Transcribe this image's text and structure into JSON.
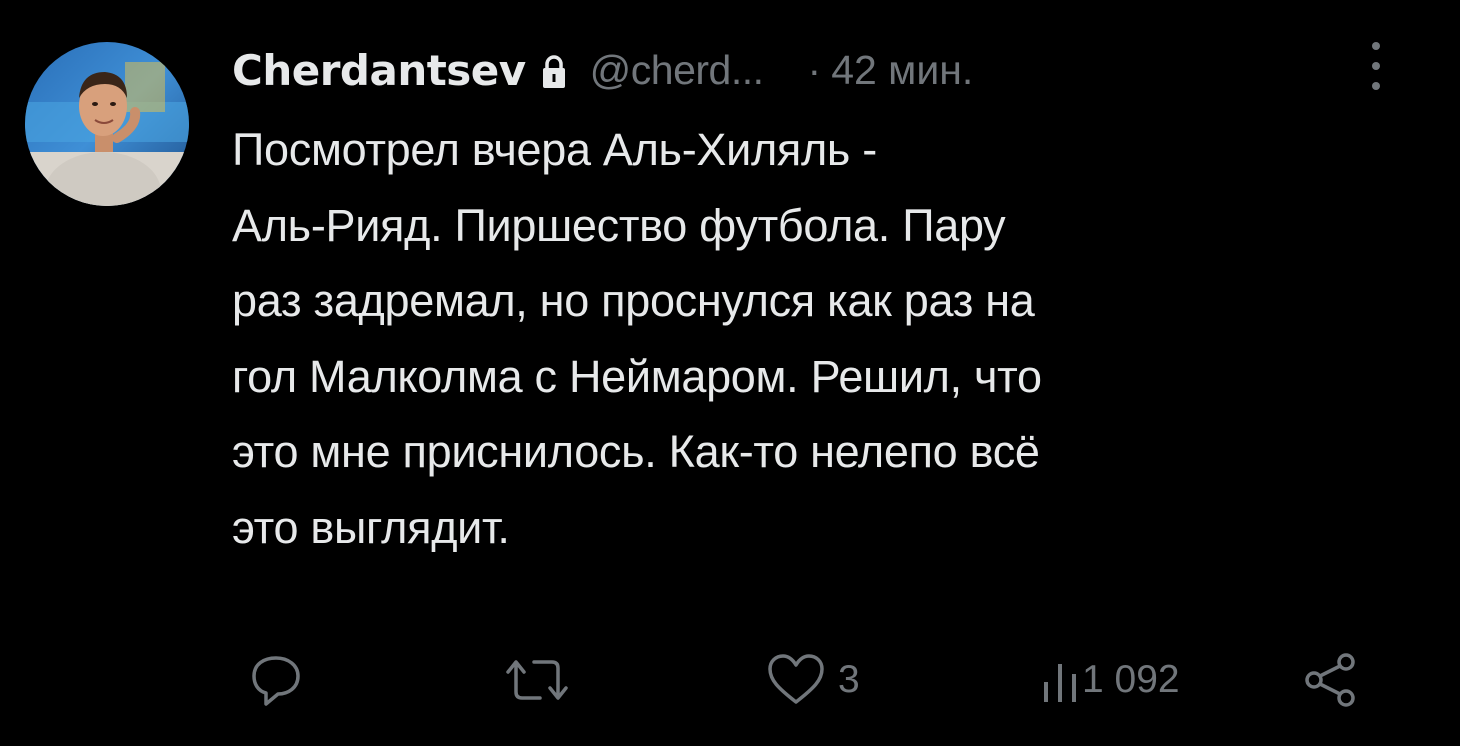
{
  "author": {
    "display_name": "Cherdantsev",
    "handle": "@cherd...",
    "separator": "·",
    "time": "42 мин.",
    "verified_icon": "lock-icon"
  },
  "tweet": {
    "lines": [
      "Посмотрел вчера Аль-Хиляль -",
      "Аль-Рияд. Пиршество футбола. Пару",
      "раз задремал, но проснулся как раз на",
      "гол Малколма с Неймаром. Решил, что",
      "это мне приснилось. Как-то нелепо всё",
      "это выглядит."
    ]
  },
  "actions": {
    "reply": {
      "icon": "reply-icon",
      "count": ""
    },
    "repost": {
      "icon": "repost-icon",
      "count": ""
    },
    "like": {
      "icon": "heart-icon",
      "count": "3"
    },
    "views": {
      "icon": "views-icon",
      "count": "1 092"
    },
    "share": {
      "icon": "share-icon"
    }
  },
  "more_icon": "more-vertical-icon",
  "colors": {
    "background": "#000000",
    "primary_text": "#e7e9ea",
    "secondary_text": "#71767b"
  }
}
